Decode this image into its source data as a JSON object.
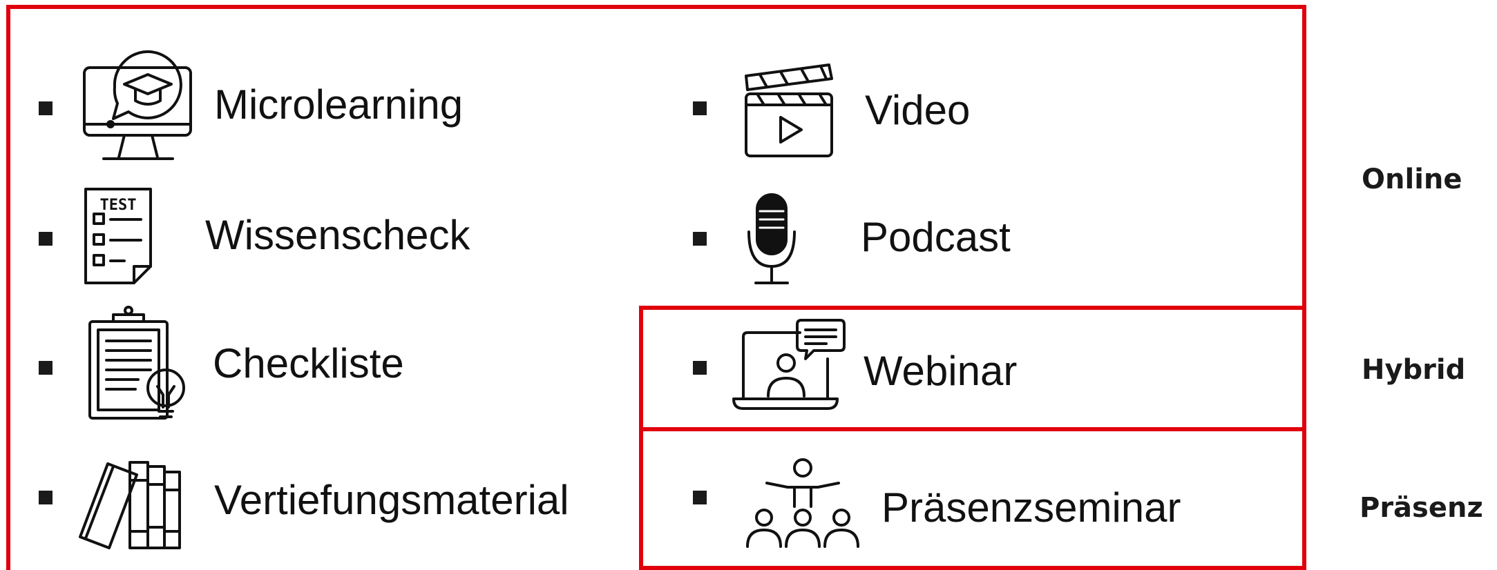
{
  "items": {
    "microlearning": "Microlearning",
    "wissenscheck": "Wissenscheck",
    "checkliste": "Checkliste",
    "vertiefungsmaterial": "Vertiefungsmaterial",
    "video": "Video",
    "podcast": "Podcast",
    "webinar": "Webinar",
    "praesenzseminar": "Präsenzseminar"
  },
  "icon_text": {
    "test": "TEST"
  },
  "categories": {
    "online": "Online",
    "hybrid": "Hybrid",
    "praesenz": "Präsenz"
  },
  "colors": {
    "frame": "#e0000c",
    "text": "#111111"
  }
}
